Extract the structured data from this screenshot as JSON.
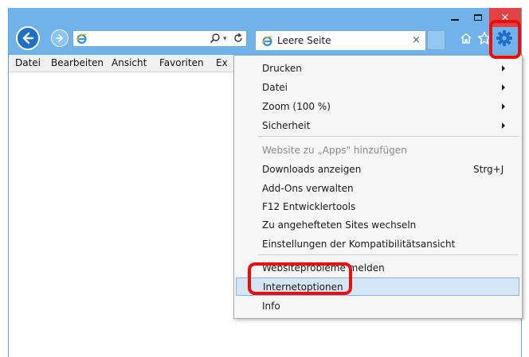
{
  "window": {
    "address_value": "",
    "tab_title": "Leere Seite",
    "close_glyph": "×",
    "tab_close_glyph": "×"
  },
  "menubar": {
    "items": [
      "Datei",
      "Bearbeiten",
      "Ansicht",
      "Favoriten",
      "Ex"
    ]
  },
  "tools_menu": {
    "items": [
      {
        "label": "Drucken",
        "submenu": true
      },
      {
        "label": "Datei",
        "submenu": true
      },
      {
        "label": "Zoom (100 %)",
        "submenu": true
      },
      {
        "label": "Sicherheit",
        "submenu": true
      },
      {
        "label": "Website zu „Apps\" hinzufügen",
        "disabled": true
      },
      {
        "label": "Downloads anzeigen",
        "shortcut": "Strg+J"
      },
      {
        "label": "Add-Ons verwalten"
      },
      {
        "label": "F12 Entwicklertools"
      },
      {
        "label": "Zu angehefteten Sites wechseln"
      },
      {
        "label": "Einstellungen der Kompatibilitätsansicht"
      },
      {
        "label": "Websiteprobleme melden"
      },
      {
        "label": "Internetoptionen",
        "highlighted": true
      },
      {
        "label": "Info"
      }
    ]
  },
  "icons": {
    "back": "back-arrow-icon",
    "forward": "forward-arrow-icon",
    "search": "search-icon",
    "refresh": "refresh-icon",
    "home": "home-icon",
    "favorites": "star-icon",
    "tools": "gear-icon"
  },
  "colors": {
    "chrome": "#6fb3ea",
    "accent": "#1e6fc9",
    "highlight": "#d5e6f7",
    "annotation": "#ee0c0c"
  }
}
